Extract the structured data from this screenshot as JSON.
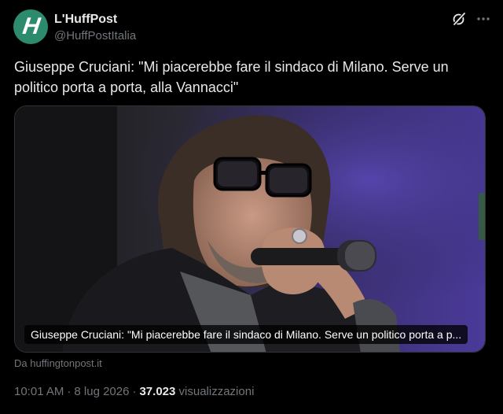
{
  "author": {
    "avatar_letter": "H",
    "avatar_color": "#2c8a6d",
    "display_name": "L'HuffPost",
    "handle": "@HuffPostItalia"
  },
  "header_icons": [
    "grok-icon",
    "more-icon"
  ],
  "tweet": {
    "text": "Giuseppe Cruciani: \"Mi piacerebbe fare il sindaco di Milano. Serve un politico porta a porta, alla Vannacci\""
  },
  "link_card": {
    "caption": "Giuseppe Cruciani: \"Mi piacerebbe fare il sindaco di Milano. Serve un politico porta a p...",
    "source": "Da huffingtonpost.it"
  },
  "meta": {
    "time": "10:01 AM",
    "separator": "·",
    "date": "8 lug 2026",
    "views_count": "37.023",
    "views_label": "visualizzazioni"
  },
  "colors": {
    "background": "#000000",
    "text_primary": "#e7e9ea",
    "text_secondary": "#71767b",
    "border": "#2f3336"
  }
}
